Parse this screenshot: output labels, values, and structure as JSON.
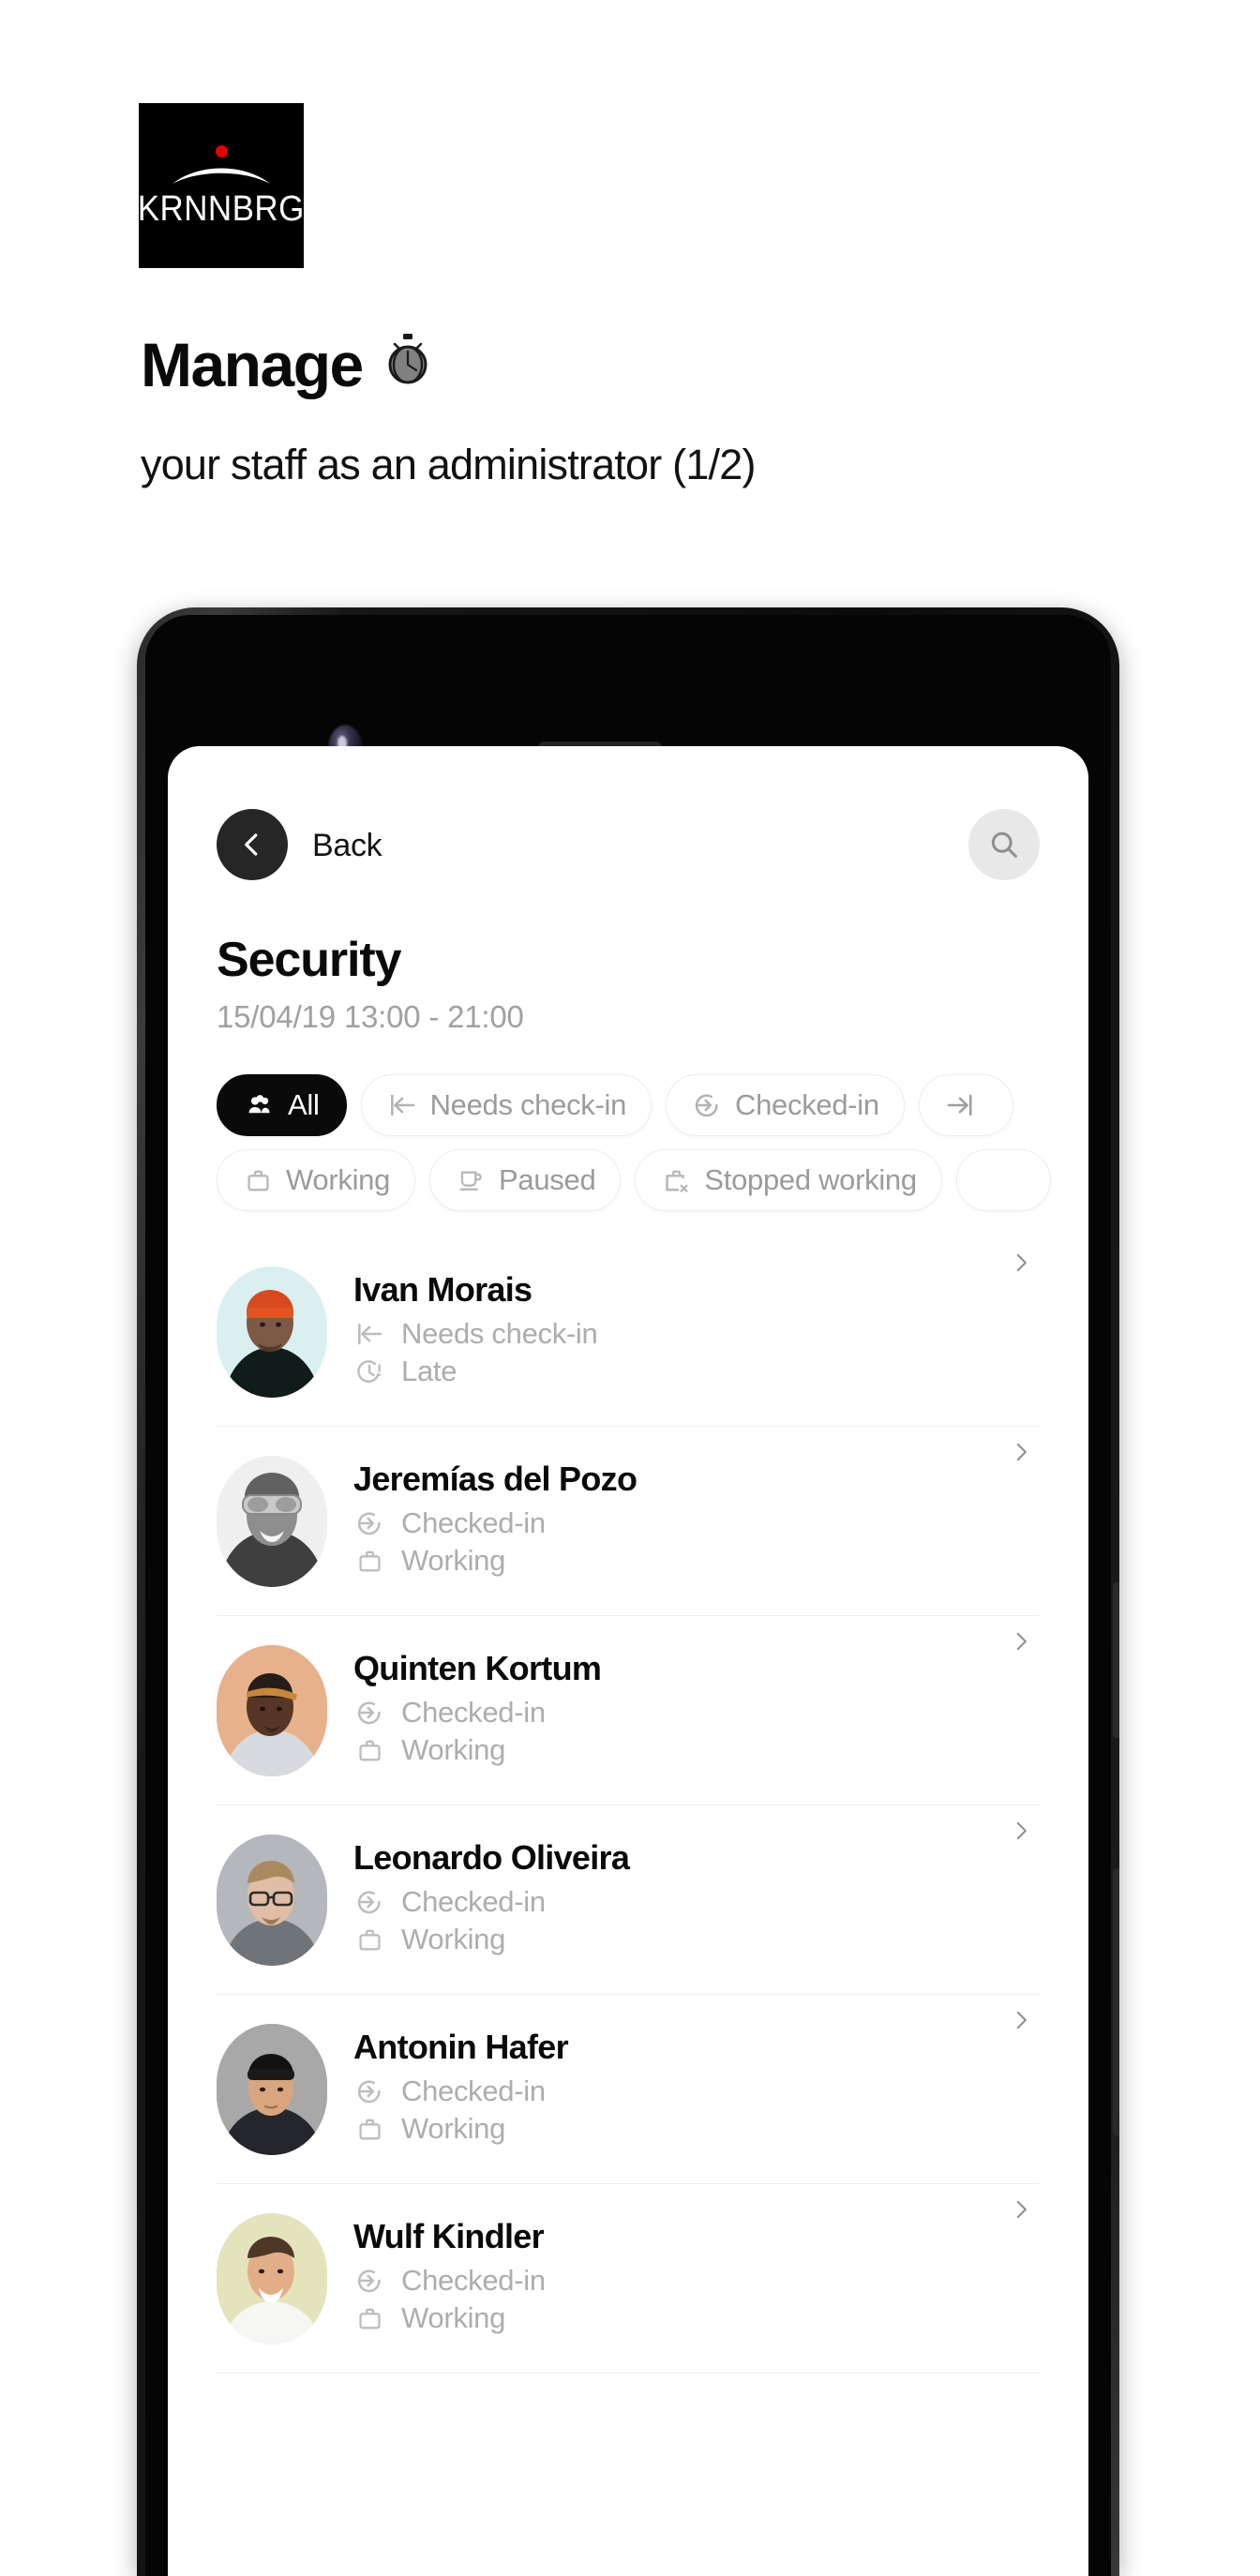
{
  "brand": {
    "logo_word": "KRNNBRG",
    "logo_dot_color": "#e60000"
  },
  "marketing": {
    "headline": "Manage",
    "headline_emoji": "⏱",
    "subheadline": "your staff as an administrator (1/2)"
  },
  "app": {
    "nav": {
      "back_label": "Back",
      "back_icon": "chevron-left-icon",
      "search_icon": "search-icon"
    },
    "header": {
      "title": "Security",
      "schedule": "15/04/19 13:00 - 21:00"
    },
    "filters": [
      [
        {
          "label": "All",
          "icon": "people-icon",
          "active": true
        },
        {
          "label": "Needs check-in",
          "icon": "check-in-needed-icon",
          "active": false
        },
        {
          "label": "Checked-in",
          "icon": "checked-in-icon",
          "active": false
        },
        {
          "label": "",
          "icon": "checked-out-icon",
          "active": false
        }
      ],
      [
        {
          "label": "Working",
          "icon": "briefcase-icon",
          "active": false
        },
        {
          "label": "Paused",
          "icon": "coffee-cup-icon",
          "active": false
        },
        {
          "label": "Stopped working",
          "icon": "briefcase-x-icon",
          "active": false
        },
        {
          "label": "",
          "icon": "partial-chip-icon",
          "active": false
        }
      ]
    ],
    "people": [
      {
        "name": "Ivan Morais",
        "status1": "Needs check-in",
        "status1_icon": "check-in-needed-icon",
        "status2": "Late",
        "status2_icon": "clock-alert-icon",
        "avatar_bg": "#daf0f0",
        "avatar_kind": "beanie-orange",
        "chevron_icon": "chevron-right-icon"
      },
      {
        "name": "Jeremías del Pozo",
        "status1": "Checked-in",
        "status1_icon": "checked-in-icon",
        "status2": "Working",
        "status2_icon": "briefcase-icon",
        "avatar_bg": "#efefef",
        "avatar_kind": "goggles-bw",
        "chevron_icon": "chevron-right-icon"
      },
      {
        "name": "Quinten Kortum",
        "status1": "Checked-in",
        "status1_icon": "checked-in-icon",
        "status2": "Working",
        "status2_icon": "briefcase-icon",
        "avatar_bg": "#e6b18b",
        "avatar_kind": "cap-tan",
        "chevron_icon": "chevron-right-icon"
      },
      {
        "name": "Leonardo Oliveira",
        "status1": "Checked-in",
        "status1_icon": "checked-in-icon",
        "status2": "Working",
        "status2_icon": "briefcase-icon",
        "avatar_bg": "#b4b7bb",
        "avatar_kind": "glasses-gray",
        "chevron_icon": "chevron-right-icon"
      },
      {
        "name": "Antonin Hafer",
        "status1": "Checked-in",
        "status1_icon": "checked-in-icon",
        "status2": "Working",
        "status2_icon": "briefcase-icon",
        "avatar_bg": "#a8a8a8",
        "avatar_kind": "beanie-black",
        "chevron_icon": "chevron-right-icon"
      },
      {
        "name": "Wulf Kindler",
        "status1": "Checked-in",
        "status1_icon": "checked-in-icon",
        "status2": "Working",
        "status2_icon": "briefcase-icon",
        "avatar_bg": "#e3e4bb",
        "avatar_kind": "smile-cream",
        "chevron_icon": "chevron-right-icon"
      }
    ]
  }
}
